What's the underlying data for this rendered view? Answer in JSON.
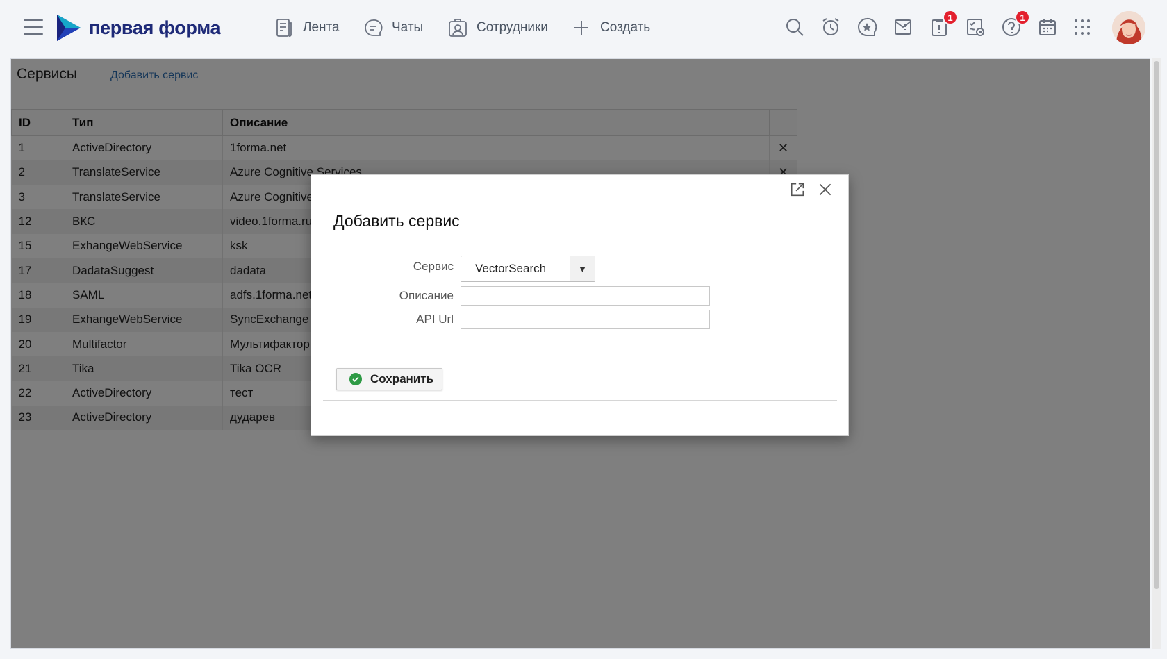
{
  "header": {
    "brand": "первая форма",
    "nav": [
      {
        "label": "Лента",
        "icon": "feed-icon"
      },
      {
        "label": "Чаты",
        "icon": "chat-icon"
      },
      {
        "label": "Сотрудники",
        "icon": "employees-icon"
      },
      {
        "label": "Создать",
        "icon": "plus-icon"
      }
    ],
    "icons": [
      "search-icon",
      "alarm-clock-icon",
      "favorites-icon",
      "announcement-icon",
      "alert-task-icon",
      "approval-icon",
      "help-icon",
      "calendar-icon",
      "apps-grid-icon"
    ],
    "badges": {
      "alert_task": "1",
      "help": "1"
    }
  },
  "page": {
    "title": "Сервисы",
    "add_link": "Добавить сервис"
  },
  "table": {
    "columns": [
      "ID",
      "Тип",
      "Описание"
    ],
    "rows": [
      {
        "id": "1",
        "type": "ActiveDirectory",
        "description": "1forma.net"
      },
      {
        "id": "2",
        "type": "TranslateService",
        "description": "Azure Cognitive Services"
      },
      {
        "id": "3",
        "type": "TranslateService",
        "description": "Azure Cognitive"
      },
      {
        "id": "12",
        "type": "ВКС",
        "description": "video.1forma.ru"
      },
      {
        "id": "15",
        "type": "ExhangeWebService",
        "description": "ksk"
      },
      {
        "id": "17",
        "type": "DadataSuggest",
        "description": "dadata"
      },
      {
        "id": "18",
        "type": "SAML",
        "description": "adfs.1forma.net"
      },
      {
        "id": "19",
        "type": "ExhangeWebService",
        "description": "SyncExchange"
      },
      {
        "id": "20",
        "type": "Multifactor",
        "description": "Мультифактор"
      },
      {
        "id": "21",
        "type": "Tika",
        "description": "Tika OCR"
      },
      {
        "id": "22",
        "type": "ActiveDirectory",
        "description": "тест"
      },
      {
        "id": "23",
        "type": "ActiveDirectory",
        "description": "дударев"
      }
    ],
    "delete_glyph": "✕"
  },
  "modal": {
    "title": "Добавить сервис",
    "service_label": "Сервис",
    "service_value": "VectorSearch",
    "description_label": "Описание",
    "description_value": "",
    "api_url_label": "API Url",
    "api_url_value": "",
    "save_label": "Сохранить"
  },
  "colors": {
    "brand_blue": "#1e2a78",
    "logo_dark": "#1a237e",
    "logo_light": "#16a6c9",
    "badge_red": "#e3202e",
    "save_green": "#2e9a45"
  }
}
